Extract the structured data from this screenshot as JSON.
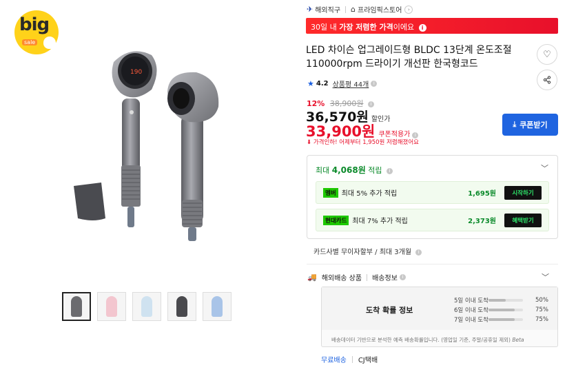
{
  "badge": {
    "big": "big",
    "sale": "sale"
  },
  "gallery": {
    "thumbnails": [
      {
        "name": "thumb-1",
        "color": "#6b6b6f",
        "active": true
      },
      {
        "name": "thumb-2",
        "color": "#f3c6cf",
        "active": false
      },
      {
        "name": "thumb-3",
        "color": "#cfe2f0",
        "active": false
      },
      {
        "name": "thumb-4",
        "color": "#4a4a4e",
        "active": false
      },
      {
        "name": "thumb-5",
        "color": "#a9c4e8",
        "active": false
      }
    ],
    "hero_display": "190"
  },
  "seller": {
    "overseas_label": "해외직구",
    "store_name": "프라임픽스토어"
  },
  "banner": {
    "prefix": "30일 내 ",
    "highlight": "가장 저렴한 가격",
    "suffix": "이에요"
  },
  "product": {
    "title": "LED 차이슨 업그레이드형 BLDC 13단계 온도조절 110000rpm 드라이기 개선판 한국형코드",
    "rating": "4.2",
    "reviews": "상품평 44개"
  },
  "price": {
    "discount_pct": "12%",
    "original": "38,900원",
    "sale": "36,570원",
    "sale_label": "할인가",
    "coupon": "33,900원",
    "coupon_label": "쿠폰적용가",
    "note": "가격인하! 어제부터 1,950원 저렴해졌어요"
  },
  "coupon_button": {
    "label": "쿠폰받기"
  },
  "points": {
    "head_prefix": "최대 ",
    "head_amount": "4,068원",
    "head_suffix": " 적립",
    "promos": [
      {
        "tag": "멤버",
        "text": "최대 5% 추가 적립",
        "amount": "1,695원",
        "action": "시작하기"
      },
      {
        "tag": "현대카드",
        "text": "최대 7% 추가 적립",
        "amount": "2,373원",
        "action": "혜택받기"
      }
    ]
  },
  "installment": "카드사별 무이자할부 / 최대 3개월",
  "shipping": {
    "type": "해외배송 상품",
    "info": "배송정보",
    "arrival_title": "도착 확률 정보",
    "arrival_rows": [
      {
        "label": "5일 이내 도착",
        "pct": "50%",
        "value": 0.5
      },
      {
        "label": "6일 이내 도착",
        "pct": "75%",
        "value": 0.75
      },
      {
        "label": "7일 이내 도착",
        "pct": "75%",
        "value": 0.75
      }
    ],
    "note": "배송데이터 기반으로 분석한 예측 배송확률입니다. (영업일 기준, 주말/공휴일 제외)",
    "beta": "Beta",
    "free": "무료배송",
    "carrier": "CJ택배"
  },
  "colors": {
    "accent_red": "#e8102b",
    "accent_blue": "#1f64e0",
    "green": "#0a8a2a"
  }
}
